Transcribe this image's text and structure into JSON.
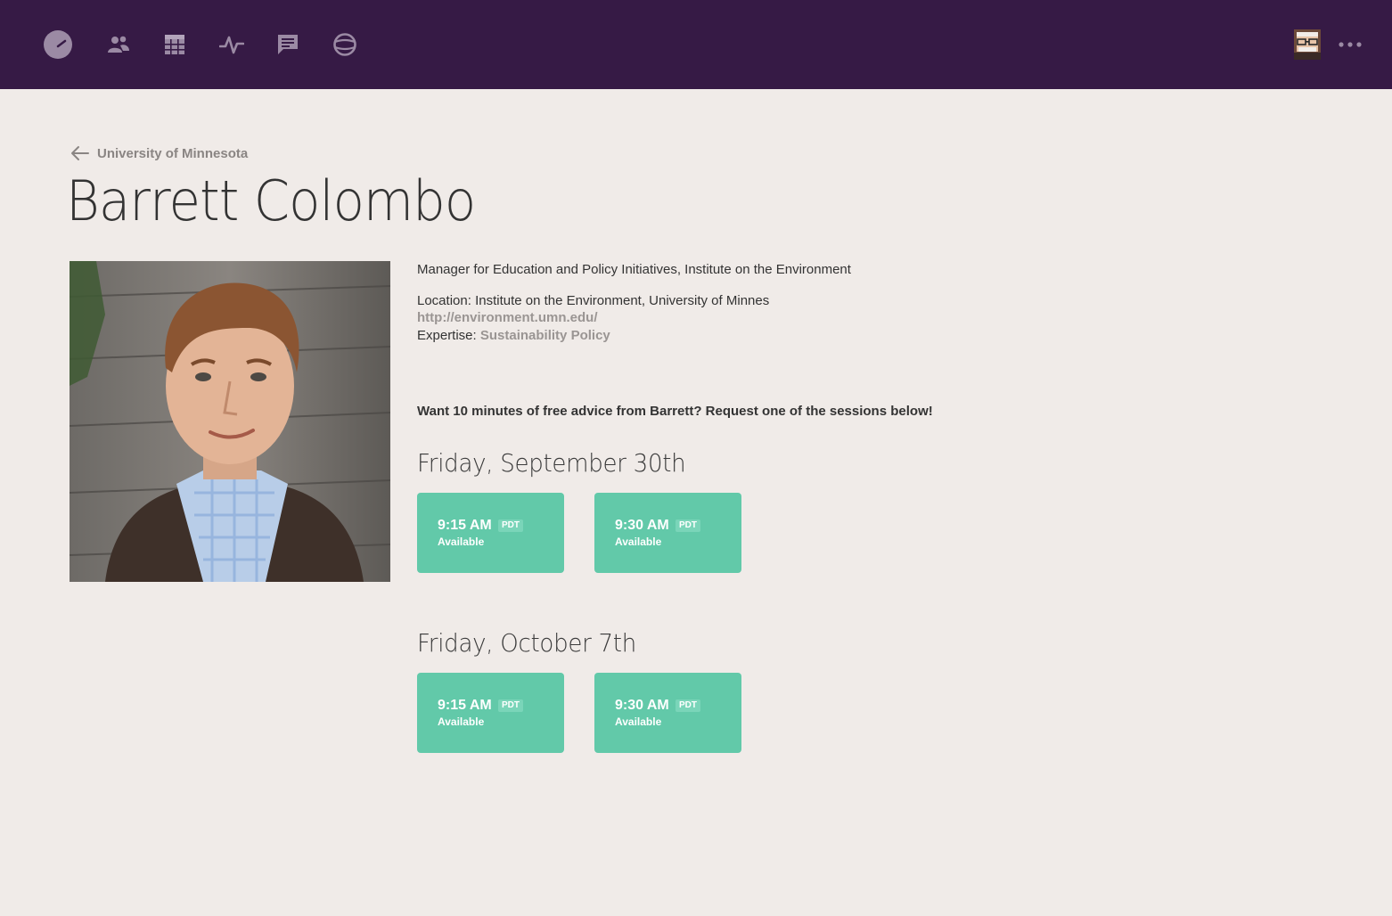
{
  "nav": {
    "items": [
      {
        "icon": "dashboard-gauge-icon"
      },
      {
        "icon": "people-icon"
      },
      {
        "icon": "calendar-grid-icon"
      },
      {
        "icon": "activity-pulse-icon"
      },
      {
        "icon": "chat-icon"
      },
      {
        "icon": "globe-icon"
      }
    ],
    "user_avatar_icon": "user-avatar",
    "more_icon": "more-dots-icon"
  },
  "breadcrumb": {
    "back_label": "University of Minnesota"
  },
  "profile": {
    "name": "Barrett Colombo",
    "job_title": "Manager for Education and Policy Initiatives, Institute on the Environment",
    "location_label": "Location:",
    "location_value": "Institute on the Environment, University of Minnes",
    "website": "http://environment.umn.edu/",
    "expertise_label": "Expertise:",
    "expertise_value": "Sustainability Policy"
  },
  "cta": "Want 10 minutes of free advice from Barrett? Request one of the sessions below!",
  "days": [
    {
      "heading": "Friday, September 30th",
      "slots": [
        {
          "time": "9:15 AM",
          "tz": "PDT",
          "status": "Available"
        },
        {
          "time": "9:30 AM",
          "tz": "PDT",
          "status": "Available"
        }
      ]
    },
    {
      "heading": "Friday, October 7th",
      "slots": [
        {
          "time": "9:15 AM",
          "tz": "PDT",
          "status": "Available"
        },
        {
          "time": "9:30 AM",
          "tz": "PDT",
          "status": "Available"
        }
      ]
    }
  ],
  "colors": {
    "topbar": "#361a45",
    "background": "#f0ebe8",
    "slot": "#62c9a9",
    "muted_link": "#9a9593"
  }
}
